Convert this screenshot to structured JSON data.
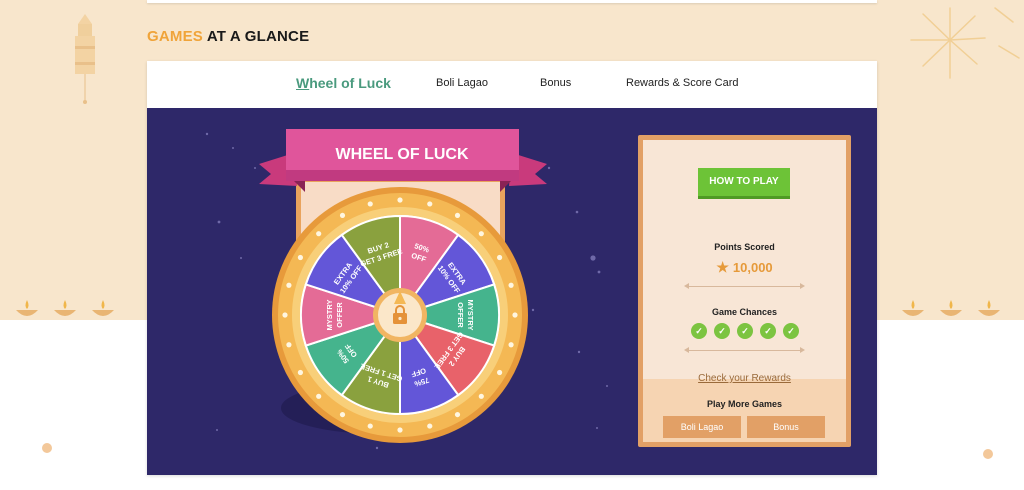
{
  "section": {
    "title_accent": "GAMES",
    "title_rest": "AT A GLANCE"
  },
  "tabs": [
    {
      "label_first": "W",
      "label_rest": "heel of Luck",
      "active": true
    },
    {
      "label": "Boli Lagao"
    },
    {
      "label": "Bonus"
    },
    {
      "label": "Rewards & Score Card"
    }
  ],
  "wheel": {
    "banner": "WHEEL OF LUCK",
    "segments": [
      {
        "line1": "50%",
        "line2": "OFF",
        "color": "#e46b96"
      },
      {
        "line1": "EXTRA",
        "line2": "10% OFF",
        "color": "#6356d8"
      },
      {
        "line1": "MYSTRY",
        "line2": "OFFER",
        "color": "#45b48d"
      },
      {
        "line1": "BUY 2",
        "line2": "GET 3 FREE",
        "color": "#e8626a"
      },
      {
        "line1": "75%",
        "line2": "OFF",
        "color": "#6356d8"
      },
      {
        "line1": "BUY 1",
        "line2": "GET 1 FREE",
        "color": "#8aa13e"
      },
      {
        "line1": "50%",
        "line2": "OFF",
        "color": "#45b48d"
      },
      {
        "line1": "MYSTRY",
        "line2": "OFFER",
        "color": "#e46b96"
      },
      {
        "line1": "EXTRA",
        "line2": "10% OFF",
        "color": "#6356d8"
      },
      {
        "line1": "BUY 2",
        "line2": "GET 3 FREE",
        "color": "#8aa13e"
      }
    ]
  },
  "panel": {
    "how_to_play": "HOW TO PLAY",
    "points_label": "Points Scored",
    "points_value": "10,000",
    "chances_label": "Game Chances",
    "chances": [
      "✓",
      "✓",
      "✓",
      "✓",
      "✓"
    ],
    "check_rewards": "Check your Rewards",
    "play_more_label": "Play More Games",
    "play_more_buttons": [
      "Boli Lagao",
      "Bonus"
    ]
  },
  "icons": {
    "star": "★",
    "lock": "lock-icon"
  },
  "colors": {
    "accent_orange": "#f0a43a",
    "stage_bg": "#2e2869",
    "active_tab": "#4a9a7e",
    "play_green": "#6dc337",
    "panel_border": "#e2a066"
  }
}
